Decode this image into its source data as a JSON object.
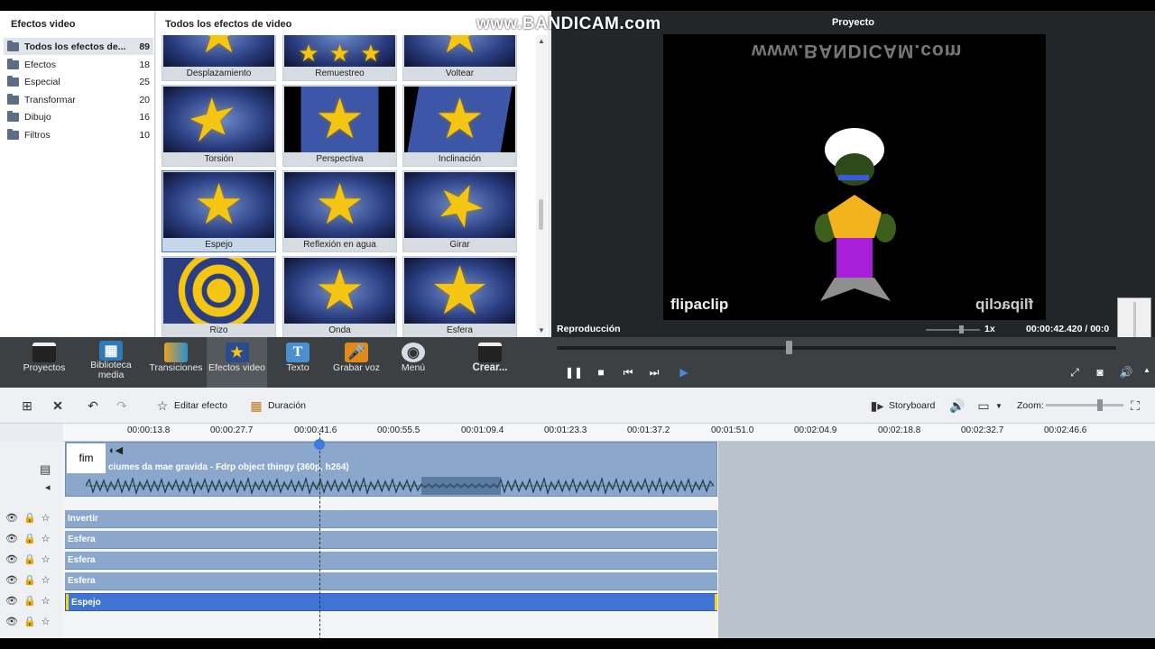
{
  "watermark": "www.BANDICAM.com",
  "categories": {
    "title": "Efectos video",
    "items": [
      {
        "label": "Todos los efectos de...",
        "count": "89"
      },
      {
        "label": "Efectos",
        "count": "18"
      },
      {
        "label": "Especial",
        "count": "25"
      },
      {
        "label": "Transformar",
        "count": "20"
      },
      {
        "label": "Dibujo",
        "count": "16"
      },
      {
        "label": "Filtros",
        "count": "10"
      }
    ]
  },
  "effects": {
    "title": "Todos los efectos de video",
    "items": [
      {
        "label": "Desplazamiento"
      },
      {
        "label": "Remuestreo"
      },
      {
        "label": "Voltear"
      },
      {
        "label": "Torsión"
      },
      {
        "label": "Perspectiva"
      },
      {
        "label": "Inclinación"
      },
      {
        "label": "Espejo"
      },
      {
        "label": "Reflexión en agua"
      },
      {
        "label": "Girar"
      },
      {
        "label": "Rizo"
      },
      {
        "label": "Onda"
      },
      {
        "label": "Esfera"
      }
    ]
  },
  "preview": {
    "title": "Proyecto",
    "video_watermark": "www.BANDICAM.com",
    "flipaclip_left": "flipaclip",
    "flipaclip_right": "flipaclip",
    "playback_label": "Reproducción",
    "speed": "1x",
    "timecode": "00:00:42.420  /  00:0"
  },
  "toolbar": {
    "items": [
      {
        "label": "Proyectos",
        "icon": "clapperboard-icon"
      },
      {
        "label": "Biblioteca media",
        "icon": "film-library-icon"
      },
      {
        "label": "Transiciones",
        "icon": "transition-icon"
      },
      {
        "label": "Efectos video",
        "icon": "star-effect-icon"
      },
      {
        "label": "Texto",
        "icon": "text-icon"
      },
      {
        "label": "Grabar voz",
        "icon": "microphone-icon"
      },
      {
        "label": "Menú",
        "icon": "menu-disc-icon"
      },
      {
        "label": "Crear...",
        "icon": "create-icon"
      }
    ]
  },
  "timeline_bar": {
    "edit_effect": "Editar efecto",
    "duration": "Duración",
    "storyboard": "Storyboard",
    "zoom": "Zoom:"
  },
  "ruler": [
    "00:00:13.8",
    "00:00:27.7",
    "00:00:41.6",
    "00:00:55.5",
    "00:01:09.4",
    "00:01:23.3",
    "00:01:37.2",
    "00:01:51.0",
    "00:02:04.9",
    "00:02:18.8",
    "00:02:32.7",
    "00:02:46.6"
  ],
  "video_clip": {
    "thumb_text": "fim",
    "title": "ciumes da mae gravida - Fdrp object thingy (360p, h264)"
  },
  "effect_clips": [
    "Invertir",
    "Esfera",
    "Esfera",
    "Esfera",
    "Espejo"
  ],
  "colors": {
    "accent": "#3f74d4",
    "clip": "#8ba7cc",
    "toolbar": "#3c4043",
    "preview_bg": "#232629"
  }
}
